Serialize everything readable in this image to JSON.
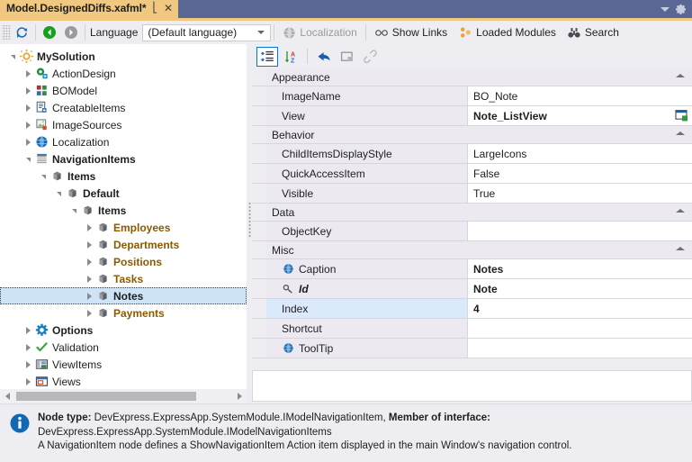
{
  "titlebar": {
    "tab_label": "Model.DesignedDiffs.xafml*",
    "pin_icon": "pin-icon",
    "close_icon": "close-icon",
    "caret_icon": "chevron-down-icon",
    "gear_icon": "gear-icon"
  },
  "toolbar": {
    "refresh_icon": "refresh-icon",
    "back_icon": "navigate-back-icon",
    "forward_icon": "navigate-forward-icon",
    "language_label": "Language",
    "language_value": "(Default language)",
    "localization_label": "Localization",
    "show_links_label": "Show Links",
    "loaded_modules_label": "Loaded Modules",
    "search_label": "Search",
    "overflow_icon": "toolbar-overflow-icon"
  },
  "tree": {
    "nodes": [
      {
        "label": "MySolution",
        "depth": 0,
        "icon": "gear-orange-icon",
        "expander": "down",
        "bold": true,
        "selected": false
      },
      {
        "label": "ActionDesign",
        "depth": 1,
        "icon": "action-design-icon",
        "expander": "right",
        "bold": false,
        "selected": false
      },
      {
        "label": "BOModel",
        "depth": 1,
        "icon": "bo-model-icon",
        "expander": "right",
        "bold": false,
        "selected": false
      },
      {
        "label": "CreatableItems",
        "depth": 1,
        "icon": "creatable-items-icon",
        "expander": "right",
        "bold": false,
        "selected": false
      },
      {
        "label": "ImageSources",
        "depth": 1,
        "icon": "image-sources-icon",
        "expander": "right",
        "bold": false,
        "selected": false
      },
      {
        "label": "Localization",
        "depth": 1,
        "icon": "globe-icon",
        "expander": "right",
        "bold": false,
        "selected": false
      },
      {
        "label": "NavigationItems",
        "depth": 1,
        "icon": "navigation-items-icon",
        "expander": "down",
        "bold": true,
        "selected": false
      },
      {
        "label": "Items",
        "depth": 2,
        "icon": "node-cube-icon",
        "expander": "down",
        "bold": true,
        "selected": false
      },
      {
        "label": "Default",
        "depth": 3,
        "icon": "node-cube-icon",
        "expander": "down",
        "bold": true,
        "selected": false
      },
      {
        "label": "Items",
        "depth": 4,
        "icon": "node-cube-icon",
        "expander": "down",
        "bold": true,
        "selected": false
      },
      {
        "label": "Employees",
        "depth": 5,
        "icon": "node-cube-icon",
        "expander": "right",
        "bold": true,
        "amber": true,
        "selected": false
      },
      {
        "label": "Departments",
        "depth": 5,
        "icon": "node-cube-icon",
        "expander": "right",
        "bold": true,
        "amber": true,
        "selected": false
      },
      {
        "label": "Positions",
        "depth": 5,
        "icon": "node-cube-icon",
        "expander": "right",
        "bold": true,
        "amber": true,
        "selected": false
      },
      {
        "label": "Tasks",
        "depth": 5,
        "icon": "node-cube-icon",
        "expander": "right",
        "bold": true,
        "amber": true,
        "selected": false
      },
      {
        "label": "Notes",
        "depth": 5,
        "icon": "node-cube-icon",
        "expander": "right",
        "bold": true,
        "selected": true
      },
      {
        "label": "Payments",
        "depth": 5,
        "icon": "node-cube-icon",
        "expander": "right",
        "bold": true,
        "amber": true,
        "selected": false
      },
      {
        "label": "Options",
        "depth": 1,
        "icon": "options-gear-icon",
        "expander": "right",
        "bold": true,
        "selected": false
      },
      {
        "label": "Validation",
        "depth": 1,
        "icon": "check-icon",
        "expander": "right",
        "bold": false,
        "selected": false
      },
      {
        "label": "ViewItems",
        "depth": 1,
        "icon": "view-items-icon",
        "expander": "right",
        "bold": false,
        "selected": false
      },
      {
        "label": "Views",
        "depth": 1,
        "icon": "views-icon",
        "expander": "right",
        "bold": false,
        "selected": false
      }
    ],
    "hscroll_left_icon": "scroll-left-arrow",
    "hscroll_right_icon": "scroll-right-arrow"
  },
  "propgrid": {
    "toolbar": {
      "categorized_icon": "categorized-view-icon",
      "alphabetical_icon": "sort-alphabetical-icon",
      "reset_icon": "reset-arrow-icon",
      "property_pages_icon": "property-pages-icon",
      "link_icon": "link-icon"
    },
    "groups": [
      {
        "name": "Appearance",
        "rows": [
          {
            "name": "ImageName",
            "value": "BO_Note",
            "bold_value": false,
            "icon": null,
            "selected": false,
            "value_icon": null
          },
          {
            "name": "View",
            "value": "Note_ListView",
            "bold_value": true,
            "icon": null,
            "selected": false,
            "value_icon": "view-window-icon"
          }
        ]
      },
      {
        "name": "Behavior",
        "rows": [
          {
            "name": "ChildItemsDisplayStyle",
            "value": "LargeIcons",
            "bold_value": false,
            "icon": null,
            "selected": false,
            "value_icon": null
          },
          {
            "name": "QuickAccessItem",
            "value": "False",
            "bold_value": false,
            "icon": null,
            "selected": false,
            "value_icon": null
          },
          {
            "name": "Visible",
            "value": "True",
            "bold_value": false,
            "icon": null,
            "selected": false,
            "value_icon": null
          }
        ]
      },
      {
        "name": "Data",
        "rows": [
          {
            "name": "ObjectKey",
            "value": "",
            "bold_value": false,
            "icon": null,
            "selected": false,
            "value_icon": null
          }
        ]
      },
      {
        "name": "Misc",
        "rows": [
          {
            "name": "Caption",
            "value": "Notes",
            "bold_value": true,
            "icon": "globe-icon",
            "selected": false,
            "value_icon": null
          },
          {
            "name": "Id",
            "value": "Note",
            "bold_value": true,
            "icon": "key-icon",
            "name_italic": true,
            "selected": false,
            "value_icon": null
          },
          {
            "name": "Index",
            "value": "4",
            "bold_value": true,
            "icon": null,
            "selected": true,
            "value_icon": null
          },
          {
            "name": "Shortcut",
            "value": "",
            "bold_value": false,
            "icon": null,
            "selected": false,
            "value_icon": null
          },
          {
            "name": "ToolTip",
            "value": "",
            "bold_value": false,
            "icon": "globe-icon",
            "selected": false,
            "value_icon": null
          }
        ]
      }
    ]
  },
  "infobar": {
    "icon": "info-icon",
    "line1_label": "Node type:",
    "line1_value": "DevExpress.ExpressApp.SystemModule.IModelNavigationItem,",
    "line1_label2": "Member of interface:",
    "line2": "DevExpress.ExpressApp.SystemModule.IModelNavigationItems",
    "line3": "A NavigationItem node defines a ShowNavigationItem Action item displayed in the main Window's navigation control."
  },
  "colors": {
    "tab_accent": "#f0c87f",
    "titlebar": "#5a6794",
    "selection": "#cde4f7",
    "grid_category": "#eceaf0",
    "accent_blue": "#0078d7",
    "amber_text": "#8a5a00"
  }
}
